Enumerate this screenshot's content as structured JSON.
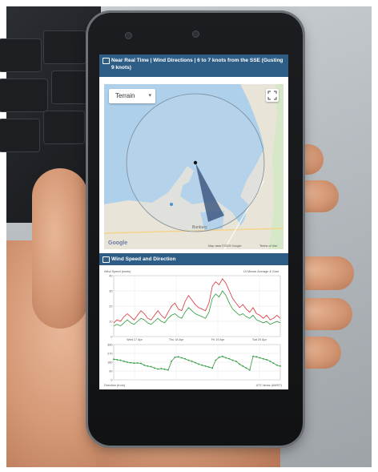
{
  "map_panel": {
    "title": "Near Real Time | Wind Directions | 6 to 7 knots from the SSE (Gusting 9 knots)",
    "terrain_label": "Terrain",
    "map_labels": [
      {
        "text": "Bunbury"
      },
      {
        "text": "Map data ©2019 Google"
      },
      {
        "text": "Terms of Use"
      }
    ],
    "google_text": "Google"
  },
  "chart_panel": {
    "title": "Wind Speed and Direction",
    "speed_label": "Wind Speed (knots)",
    "legend_text": "10 Minute Average & Gust",
    "dates": [
      "Wed 17 Apr",
      "Thu 18 Apr",
      "Fri 19 Apr",
      "Sat 20 Apr"
    ],
    "direction_label": "Direction (from)",
    "footer_right": "UTC times (AWST)"
  },
  "colors": {
    "header": "#2e5d86",
    "gust": "#d9343a",
    "average": "#2e9a3c",
    "direction": "#2e9a3c",
    "wedge": "#3f5a82",
    "map_water": "#aed0ea",
    "map_land": "#e8e4d8"
  },
  "chart_data": [
    {
      "type": "line",
      "title": "Wind Speed (knots)",
      "ylim": [
        0,
        40
      ],
      "y_ticks": [
        0,
        10,
        20,
        30,
        40
      ],
      "x_ticks": [
        "Wed 17 Apr",
        "Thu 18 Apr",
        "Fri 19 Apr",
        "Sat 20 Apr"
      ],
      "legend": "10 Minute Average & Gust",
      "series": [
        {
          "values": [
            7,
            8,
            7,
            9,
            11,
            9,
            8,
            10,
            12,
            11,
            9,
            8,
            10,
            12,
            10,
            9,
            12,
            14,
            15,
            13,
            12,
            16,
            19,
            17,
            15,
            14,
            13,
            12,
            16,
            25,
            28,
            26,
            30,
            27,
            22,
            18,
            16,
            14,
            15,
            13,
            12,
            14,
            11,
            10,
            9,
            10,
            8,
            9,
            10,
            9
          ]
        },
        {
          "values": [
            9,
            11,
            10,
            13,
            15,
            13,
            11,
            14,
            17,
            15,
            12,
            11,
            14,
            17,
            14,
            12,
            16,
            20,
            22,
            18,
            17,
            23,
            27,
            24,
            21,
            19,
            18,
            17,
            22,
            33,
            36,
            34,
            38,
            35,
            30,
            25,
            22,
            19,
            21,
            18,
            16,
            19,
            15,
            14,
            12,
            14,
            11,
            12,
            14,
            12
          ]
        }
      ]
    },
    {
      "type": "line",
      "title": "Direction (from)",
      "ylim": [
        0,
        360
      ],
      "y_ticks": [
        0,
        90,
        180,
        270,
        360
      ],
      "x_ticks": [
        "Wed 17 Apr",
        "Thu 18 Apr",
        "Fri 19 Apr",
        "Sat 20 Apr"
      ],
      "series": [
        {
          "values": [
            210,
            205,
            200,
            190,
            180,
            175,
            170,
            172,
            168,
            150,
            140,
            135,
            120,
            110,
            115,
            108,
            100,
            190,
            230,
            235,
            225,
            215,
            200,
            190,
            175,
            160,
            150,
            140,
            130,
            120,
            200,
            230,
            240,
            225,
            215,
            200,
            190,
            160,
            140,
            120,
            100,
            240,
            235,
            225,
            215,
            205,
            190,
            170,
            150,
            140
          ]
        }
      ]
    }
  ]
}
